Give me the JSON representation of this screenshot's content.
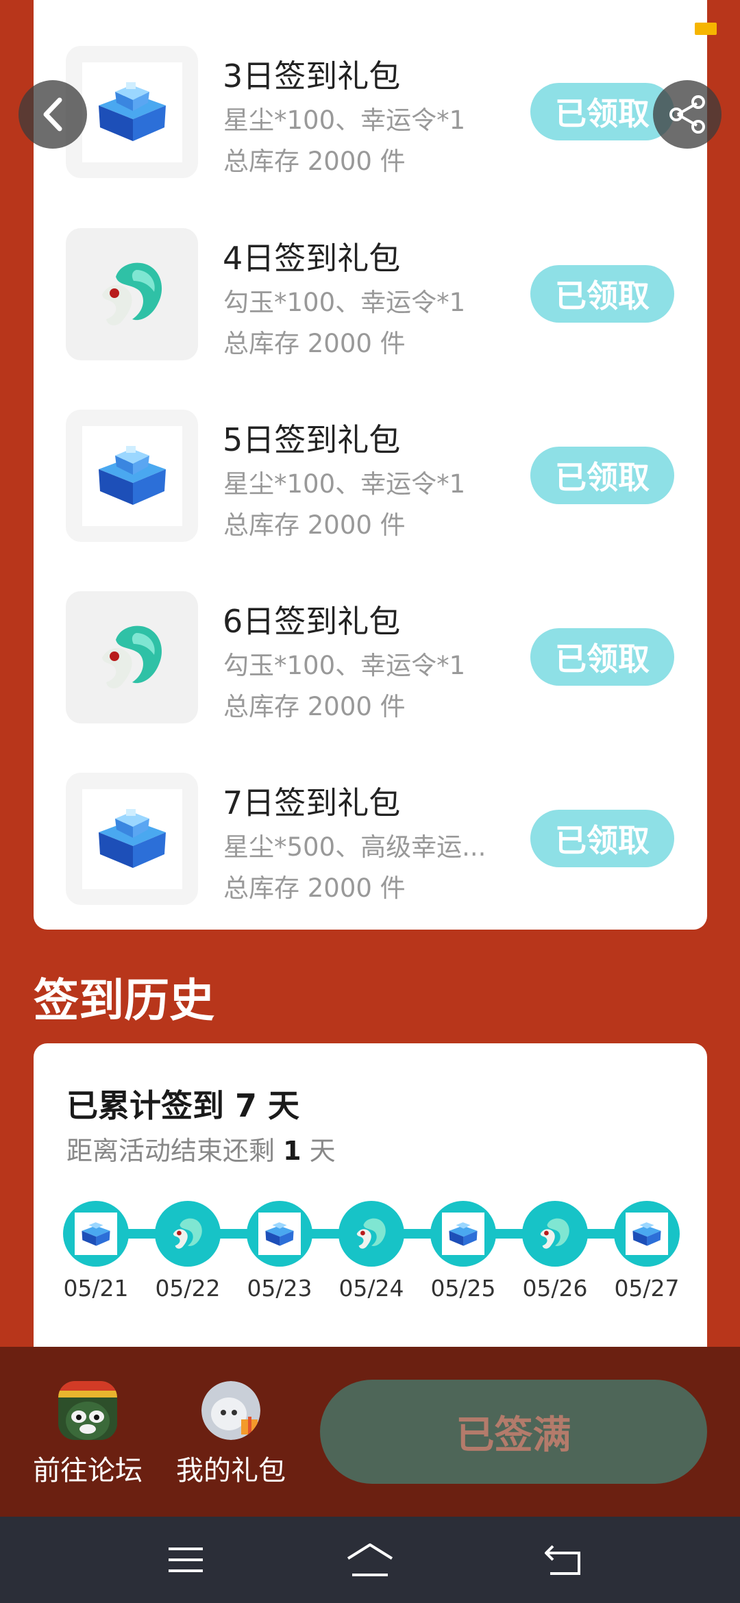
{
  "gifts": [
    {
      "title": "3日签到礼包",
      "desc": "星尘*100、幸运令*1",
      "stock": "总库存 2000 件",
      "button": "已领取",
      "icon": "blue-chest-icon"
    },
    {
      "title": "4日签到礼包",
      "desc": "勾玉*100、幸运令*1",
      "stock": "总库存 2000 件",
      "button": "已领取",
      "icon": "jade-magatama-icon"
    },
    {
      "title": "5日签到礼包",
      "desc": "星尘*100、幸运令*1",
      "stock": "总库存 2000 件",
      "button": "已领取",
      "icon": "blue-chest-icon"
    },
    {
      "title": "6日签到礼包",
      "desc": "勾玉*100、幸运令*1",
      "stock": "总库存 2000 件",
      "button": "已领取",
      "icon": "jade-magatama-icon"
    },
    {
      "title": "7日签到礼包",
      "desc": "星尘*500、高级幸运...",
      "stock": "总库存 2000 件",
      "button": "已领取",
      "icon": "blue-chest-icon"
    }
  ],
  "history": {
    "section_title": "签到历史",
    "count_text": "已累计签到 7 天",
    "remain_prefix": "距离活动结束还剩 ",
    "remain_days": "1",
    "remain_suffix": " 天",
    "days": [
      {
        "date": "05/21",
        "icon": "blue-chest-icon"
      },
      {
        "date": "05/22",
        "icon": "jade-magatama-icon"
      },
      {
        "date": "05/23",
        "icon": "blue-chest-icon"
      },
      {
        "date": "05/24",
        "icon": "jade-magatama-icon"
      },
      {
        "date": "05/25",
        "icon": "blue-chest-icon"
      },
      {
        "date": "05/26",
        "icon": "jade-magatama-icon"
      },
      {
        "date": "05/27",
        "icon": "blue-chest-icon"
      }
    ]
  },
  "bottom_bar": {
    "forum_label": "前往论坛",
    "gifts_label": "我的礼包",
    "signed_label": "已签满"
  },
  "colors": {
    "background": "#b8361b",
    "claim_button": "#8ee0e6",
    "timeline": "#17c3c7",
    "bar": "#6b2011",
    "signed_button": "#4e6658"
  }
}
